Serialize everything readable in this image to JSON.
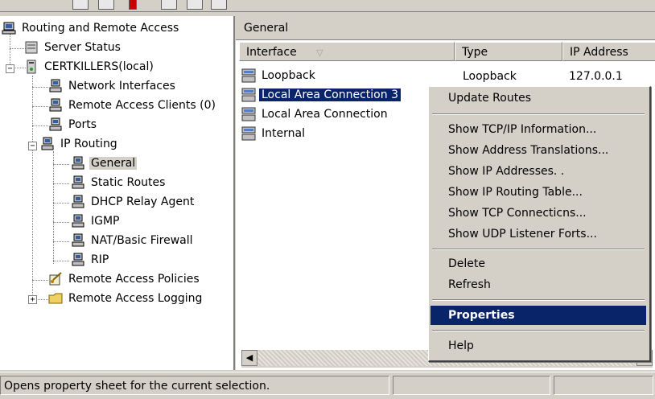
{
  "tree": {
    "root": "Routing and Remote Access",
    "server_status": "Server Status",
    "server": "CERTKILLERS(local)",
    "network_interfaces": "Network Interfaces",
    "remote_access_clients": "Remote Access Clients (0)",
    "ports": "Ports",
    "ip_routing": "IP Routing",
    "general": "General",
    "static_routes": "Static Routes",
    "dhcp_relay": "DHCP Relay Agent",
    "igmp": "IGMP",
    "nat": "NAT/Basic Firewall",
    "rip": "RIP",
    "ra_policies": "Remote Access Policies",
    "ra_logging": "Remote Access Logging"
  },
  "pane": {
    "title": "General",
    "columns": [
      "Interface",
      "Type",
      "IP Address"
    ],
    "rows": [
      {
        "name": "Loopback",
        "type": "Loopback",
        "ip": "127.0.0.1"
      },
      {
        "name": "Local Area Connection 3",
        "type": "",
        "ip": ""
      },
      {
        "name": "Local Area Connection",
        "type": "",
        "ip": ""
      },
      {
        "name": "Internal",
        "type": "",
        "ip": ""
      }
    ]
  },
  "menu": {
    "update_routes": "Update Routes",
    "show_tcpip": "Show TCP/IP Information...",
    "show_addr_trans": "Show Address Translations...",
    "show_ip_addrs": "Show IP Addresses. .",
    "show_ip_routing": "Show IP Routing Table...",
    "show_tcp_conn": "Show TCP Connecticns...",
    "show_udp": "Show UDP Listener Forts...",
    "delete": "Delete",
    "refresh": "Refresh",
    "properties": "Properties",
    "help": "Help"
  },
  "status": {
    "text": "Opens property sheet for the current selection."
  },
  "colors": {
    "selection": "#0a246a",
    "face": "#d4d0c8"
  }
}
